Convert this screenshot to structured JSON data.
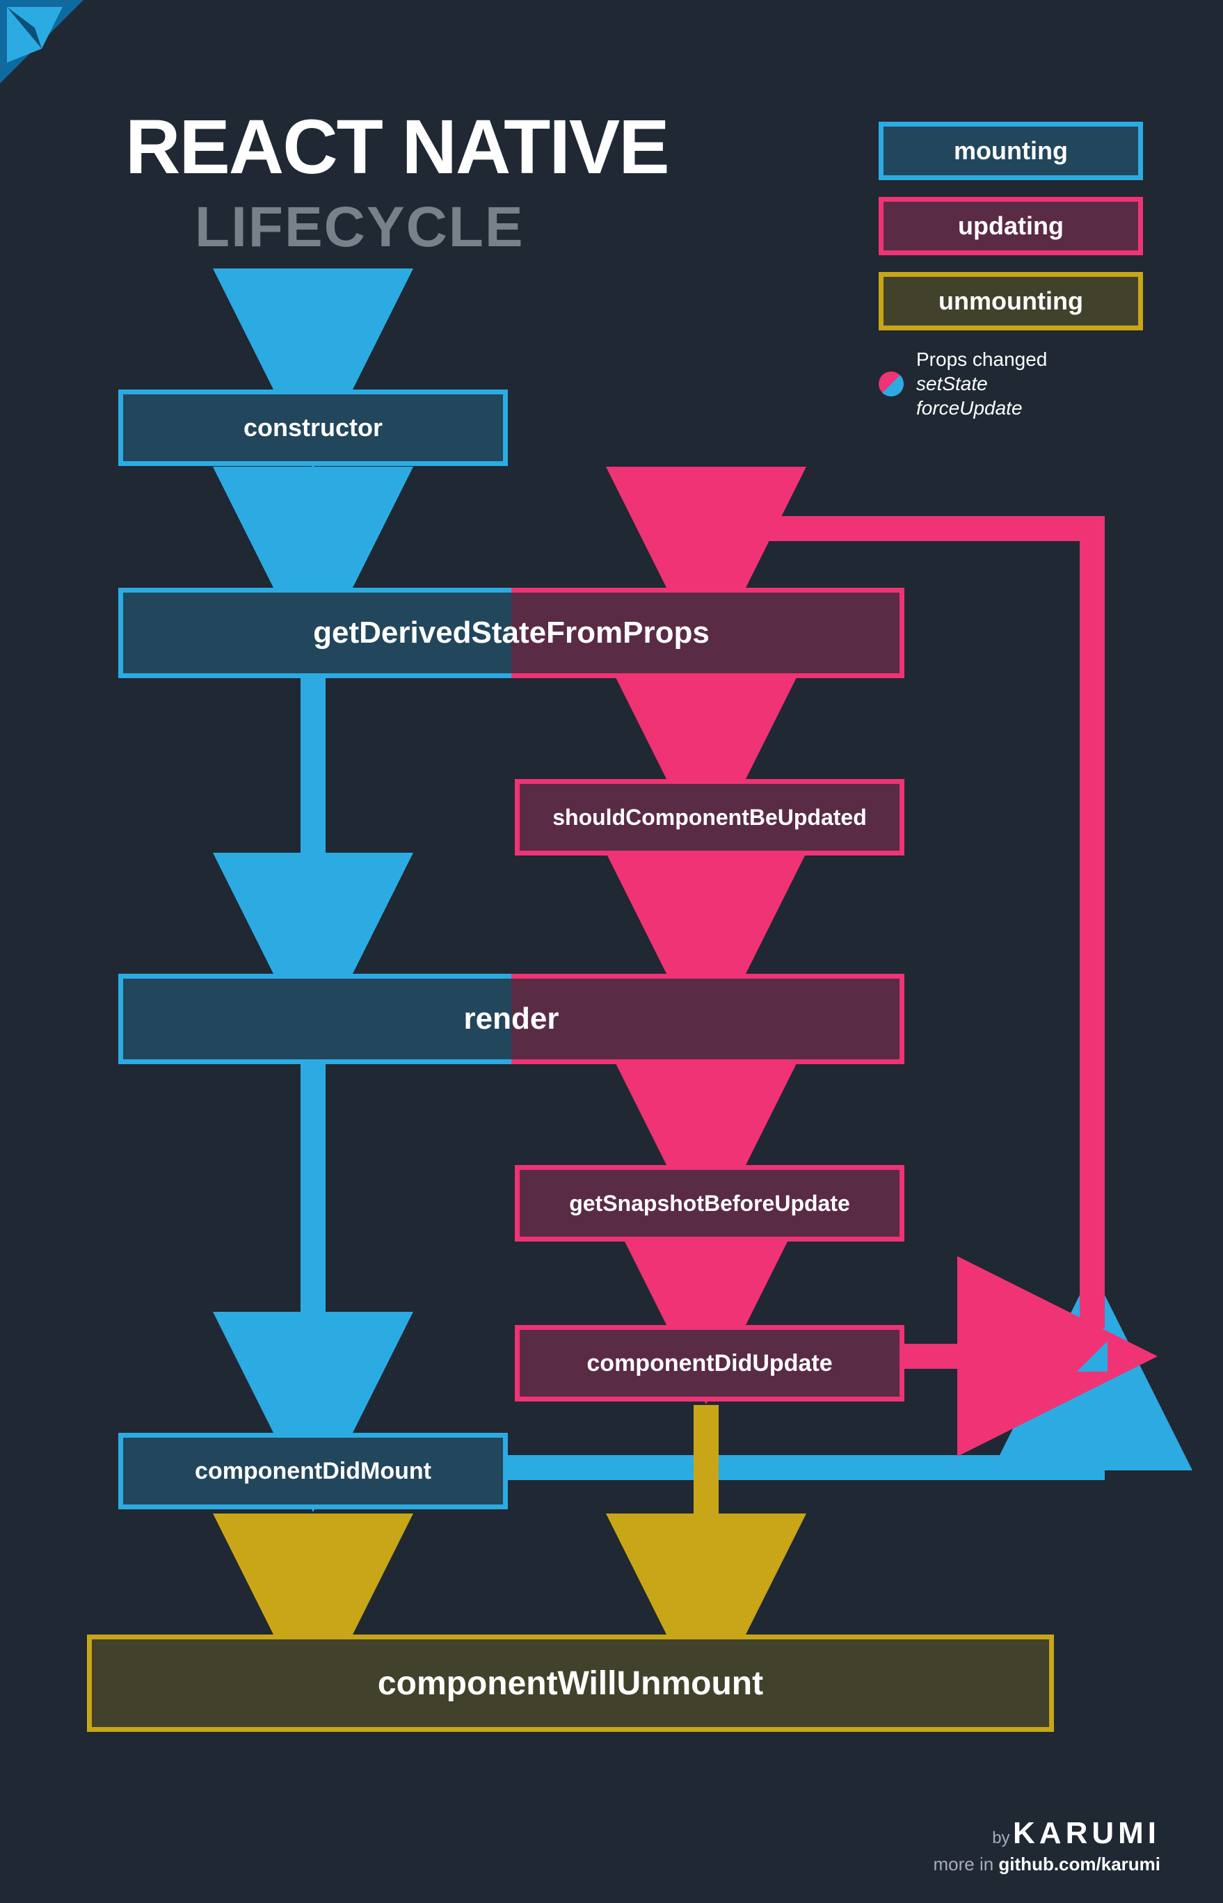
{
  "title": "REACT NATIVE",
  "subtitle": "LIFECYCLE",
  "legend": {
    "mounting": "mounting",
    "updating": "updating",
    "unmounting": "unmounting",
    "note_line1": "Props changed",
    "note_line2": "setState",
    "note_line3": "forceUpdate"
  },
  "nodes": {
    "constructor": "constructor",
    "getDerived": "getDerivedStateFromProps",
    "shouldUpdate": "shouldComponentBeUpdated",
    "render": "render",
    "getSnapshot": "getSnapshotBeforeUpdate",
    "didUpdate": "componentDidUpdate",
    "didMount": "componentDidMount",
    "willUnmount": "componentWillUnmount"
  },
  "colors": {
    "bg": "#1f2833",
    "mounting_border": "#2cabe3",
    "mounting_fill": "#22465c",
    "updating_border": "#ef3375",
    "updating_fill": "#5a2b45",
    "unmounting_border": "#c8a617",
    "unmounting_fill": "#42422c",
    "arrow_blue": "#2cabe3",
    "arrow_pink": "#ef3375",
    "arrow_gold": "#c8a617"
  },
  "footer": {
    "by_label": "by",
    "brand": "KARUMI",
    "more_label": "more in",
    "link": "github.com/karumi"
  }
}
